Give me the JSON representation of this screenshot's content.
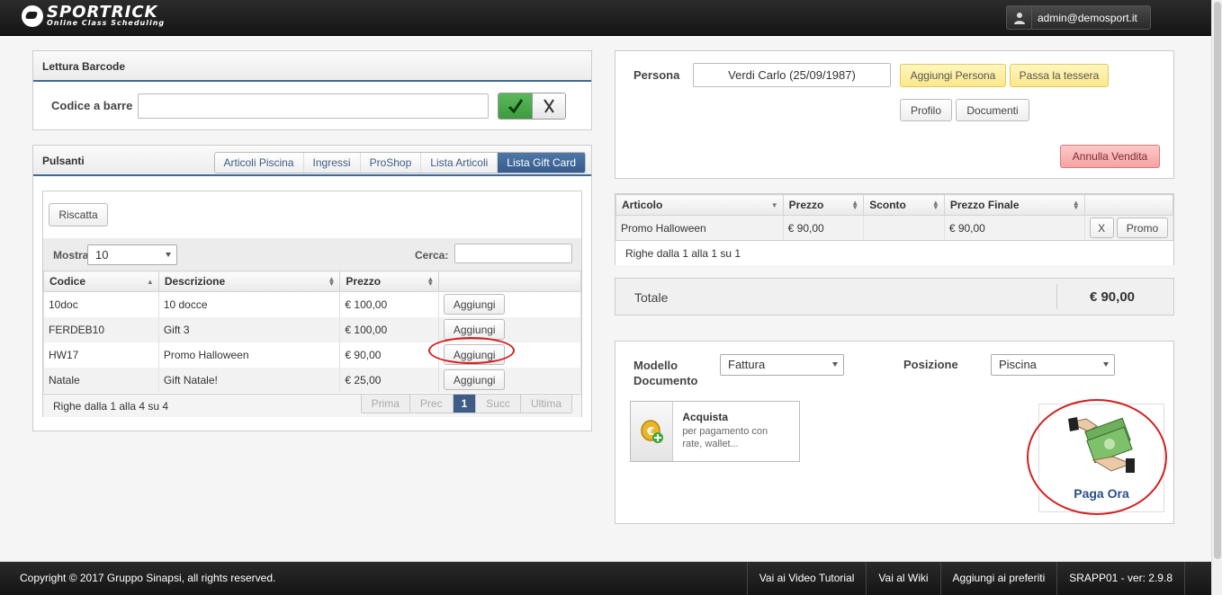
{
  "header": {
    "logo_text": "SPORTRICK",
    "logo_subtitle": "Online Class Scheduling",
    "user_label": "admin@demosport.it",
    "user_icon": "user-icon"
  },
  "barcode": {
    "title": "Lettura Barcode",
    "field_label": "Codice a barre",
    "value": "",
    "confirm_icon": "checkmark-icon",
    "clear_icon": "x-mark-icon"
  },
  "buttons_panel": {
    "title": "Pulsanti",
    "tabs": [
      "Articoli Piscina",
      "Ingressi",
      "ProShop",
      "Lista Articoli",
      "Lista Gift Card"
    ],
    "active_tab": "Lista Gift Card",
    "redeem_label": "Riscatta",
    "show_label": "Mostra",
    "show_value": "10",
    "search_label": "Cerca:",
    "search_value": "",
    "columns": [
      "Codice",
      "Descrizione",
      "Prezzo",
      ""
    ],
    "rows": [
      {
        "code": "10doc",
        "desc": "10 docce",
        "price": "€ 100,00",
        "action": "Aggiungi"
      },
      {
        "code": "FERDEB10",
        "desc": "Gift 3",
        "price": "€ 100,00",
        "action": "Aggiungi"
      },
      {
        "code": "HW17",
        "desc": "Promo Halloween",
        "price": "€ 90,00",
        "action": "Aggiungi"
      },
      {
        "code": "Natale",
        "desc": "Gift Natale!",
        "price": "€ 25,00",
        "action": "Aggiungi"
      }
    ],
    "info": "Righe dalla 1 alla 4 su 4",
    "pager": {
      "first": "Prima",
      "prev": "Prec",
      "current": "1",
      "next": "Succ",
      "last": "Ultima"
    }
  },
  "person": {
    "label": "Persona",
    "value": "Verdi Carlo (25/09/1987)",
    "add_person": "Aggiungi Persona",
    "swipe_card": "Passa la tessera",
    "profile": "Profilo",
    "documents": "Documenti",
    "cancel_sale": "Annulla Vendita"
  },
  "cart": {
    "columns": [
      "Articolo",
      "Prezzo",
      "Sconto",
      "Prezzo Finale",
      ""
    ],
    "rows": [
      {
        "item": "Promo Halloween",
        "price": "€ 90,00",
        "discount": "",
        "final": "€ 90,00",
        "remove": "X",
        "promo": "Promo"
      }
    ],
    "info": "Righe dalla 1 alla 1 su 1"
  },
  "total": {
    "label": "Totale",
    "value": "€ 90,00"
  },
  "checkout": {
    "model_label": "Modello Documento",
    "model_value": "Fattura",
    "position_label": "Posizione",
    "position_value": "Piscina",
    "buy_title": "Acquista",
    "buy_desc": "per pagamento con rate, wallet...",
    "buy_icon": "coin-add-icon",
    "pay_label": "Paga Ora",
    "pay_icon": "money-hands-icon"
  },
  "footer": {
    "copyright": "Copyright © 2017 Gruppo Sinapsi, all rights reserved.",
    "links": [
      "Vai ai Video Tutorial",
      "Vai al Wiki",
      "Aggiungi ai preferiti",
      "SRAPP01 - ver: 2.9.8"
    ]
  },
  "colors": {
    "accent": "#3d5d86",
    "highlight": "#d32020",
    "yellow": "#fbe98a",
    "red_button": "#f5a3a3"
  }
}
